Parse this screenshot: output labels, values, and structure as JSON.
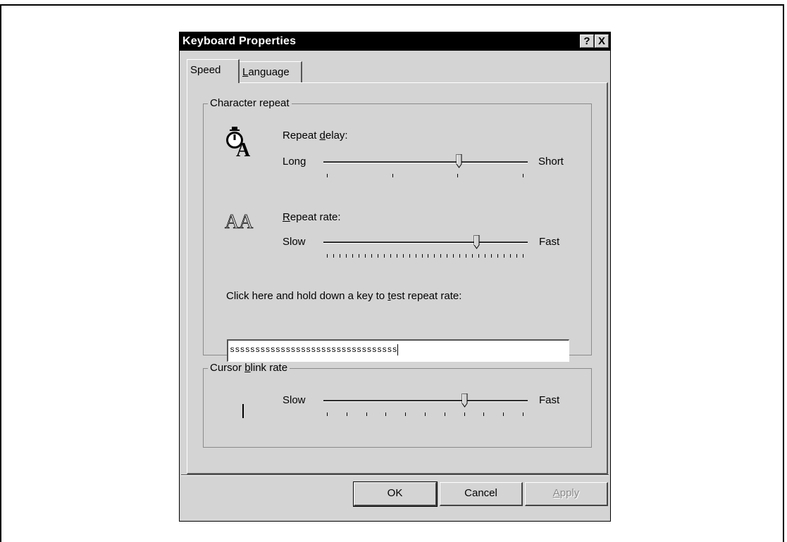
{
  "window": {
    "title": "Keyboard Properties",
    "help_button": "?",
    "close_button": "X"
  },
  "tabs": [
    {
      "label": "Speed",
      "active": true
    },
    {
      "label": "Language",
      "active": false
    }
  ],
  "character_repeat": {
    "group_label": "Character repeat",
    "repeat_delay": {
      "label": "Repeat delay:",
      "min_label": "Long",
      "max_label": "Short",
      "position": 0.67,
      "ticks": 4
    },
    "repeat_rate": {
      "label": "Repeat rate:",
      "min_label": "Slow",
      "max_label": "Fast",
      "position": 0.76,
      "ticks": 32
    },
    "test_label": "Click here and hold down a key to test repeat rate:",
    "test_value": "sssssssssssssssssssssssssssssssss"
  },
  "cursor_blink": {
    "group_label": "Cursor blink rate",
    "min_label": "Slow",
    "max_label": "Fast",
    "position": 0.7,
    "ticks": 11
  },
  "buttons": {
    "ok": "OK",
    "cancel": "Cancel",
    "apply": "Apply"
  },
  "icons": {
    "repeat_delay_icon": "stopwatch-letter-a-icon",
    "repeat_rate_icon": "repeated-letter-a-icon",
    "cursor_icon": "text-cursor-icon"
  }
}
